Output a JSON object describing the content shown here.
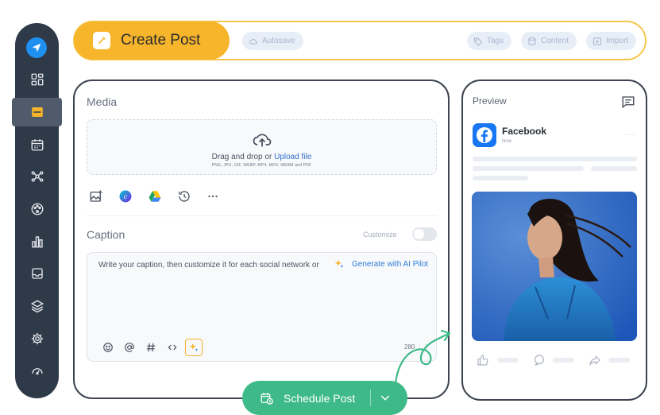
{
  "sidebar": {
    "items": [
      {
        "icon": "dashboard-icon",
        "active": false
      },
      {
        "icon": "compose-icon",
        "active": true
      },
      {
        "icon": "calendar-icon",
        "active": false
      },
      {
        "icon": "network-icon",
        "active": false
      },
      {
        "icon": "palette-icon",
        "active": false
      },
      {
        "icon": "analytics-icon",
        "active": false
      },
      {
        "icon": "inbox-icon",
        "active": false
      },
      {
        "icon": "layers-icon",
        "active": false
      },
      {
        "icon": "settings-icon",
        "active": false
      },
      {
        "icon": "support-icon",
        "active": false
      }
    ]
  },
  "topbar": {
    "title": "Create Post",
    "autosave": "Autosave",
    "tags": "Tags",
    "content": "Content",
    "import": "Import"
  },
  "media": {
    "title": "Media",
    "drop_text": "Drag and drop or ",
    "upload_link": "Upload file",
    "formats": "PNG, JPG, GIF, WEBP, MP4, MOV, WEBM and PDF"
  },
  "caption": {
    "title": "Caption",
    "customize_label": "Customize",
    "placeholder": "Write your caption, then customize it for each social network or",
    "ai_link": "Generate with AI Pilot",
    "char_count": "280",
    "char_suffix": "⋮⋮"
  },
  "schedule": {
    "label": "Schedule Post"
  },
  "preview": {
    "title": "Preview",
    "network": "Facebook",
    "time": "Now",
    "more": "···"
  },
  "colors": {
    "sidebar_bg": "#2f3a49",
    "accent_yellow": "#f7b52c",
    "accent_green": "#3dba87",
    "link_blue": "#2f6fd0",
    "facebook_blue": "#1877f2"
  }
}
